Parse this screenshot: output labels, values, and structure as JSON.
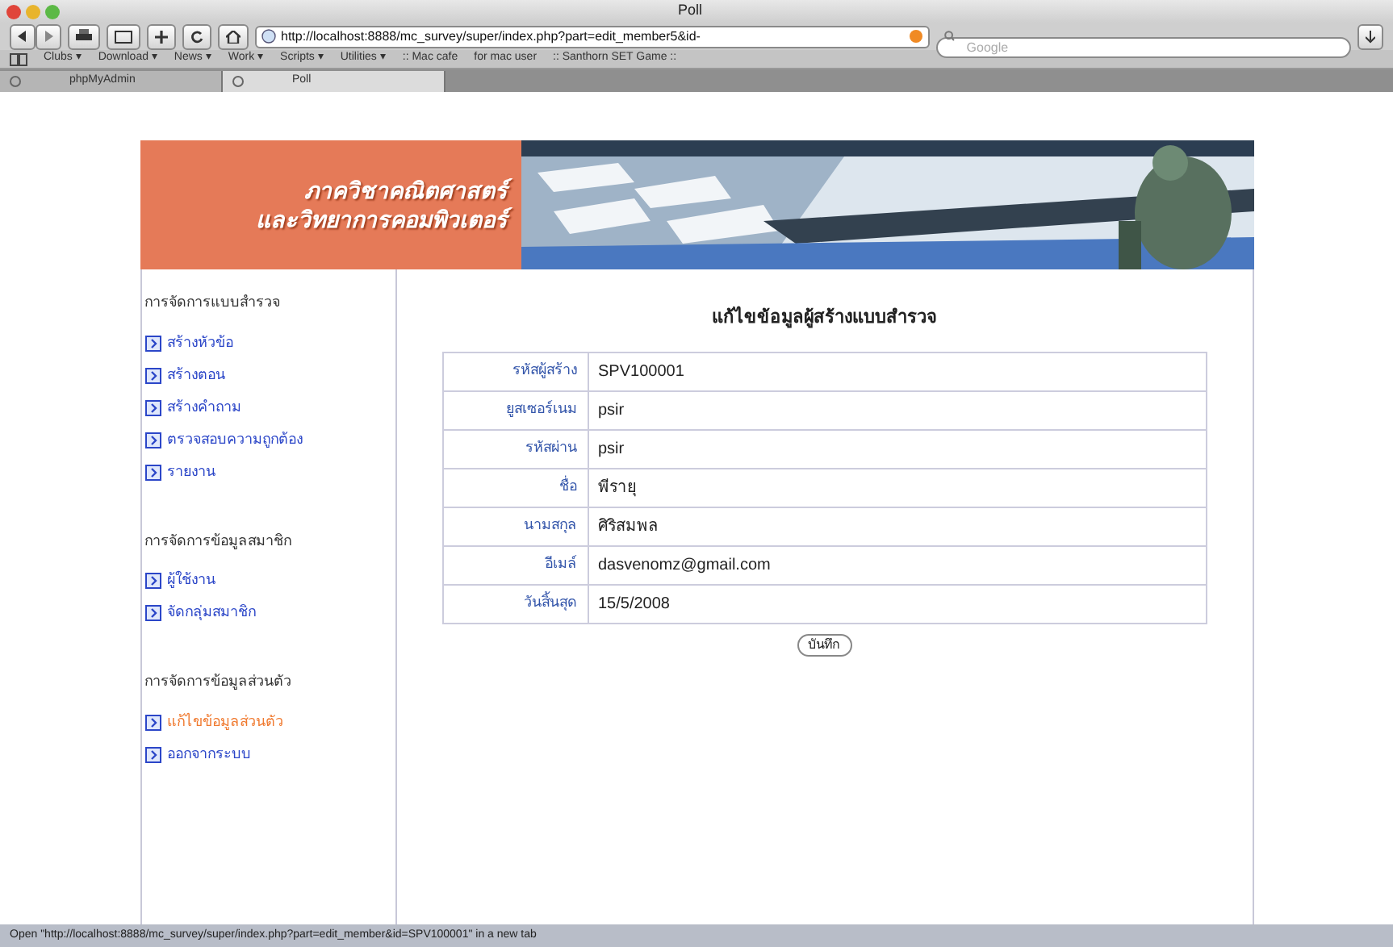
{
  "window": {
    "title": "Poll"
  },
  "toolbar": {
    "url": "http://localhost:8888/mc_survey/super/index.php?part=edit_member5&id-",
    "search_placeholder": "Google"
  },
  "bookmarks": [
    "Clubs ▾",
    "Download ▾",
    "News ▾",
    "Work ▾",
    "Scripts ▾",
    "Utilities ▾",
    ":: Mac cafe",
    "for mac user",
    ":: Santhorn SET Game ::"
  ],
  "tabs": [
    {
      "label": "phpMyAdmin",
      "selected": false
    },
    {
      "label": "Poll",
      "selected": true
    }
  ],
  "banner": {
    "title_lines": [
      "ภาควิชาคณิตศาสตร์",
      "และวิทยาการคอมพิวเตอร์"
    ]
  },
  "sidebar": {
    "sections": [
      {
        "heading": "การจัดการแบบสำรวจ",
        "items": [
          {
            "label": "สร้างหัวข้อ",
            "selected": false
          },
          {
            "label": "สร้างตอน",
            "selected": false
          },
          {
            "label": "สร้างคำถาม",
            "selected": false
          },
          {
            "label": "ตรวจสอบความถูกต้อง",
            "selected": false
          },
          {
            "label": "รายงาน",
            "selected": false
          }
        ]
      },
      {
        "heading": "การจัดการข้อมูลสมาชิก",
        "items": [
          {
            "label": "ผู้ใช้งาน",
            "selected": false
          },
          {
            "label": "จัดกลุ่มสมาชิก",
            "selected": false
          }
        ]
      },
      {
        "heading": "การจัดการข้อมูลส่วนตัว",
        "items": [
          {
            "label": "แก้ไขข้อมูลส่วนตัว",
            "selected": true
          },
          {
            "label": "ออกจากระบบ",
            "selected": false
          }
        ]
      }
    ]
  },
  "form": {
    "title": "แก้ไขข้อมูลผู้สร้างแบบสำรวจ",
    "rows": [
      {
        "label": "รหัสผู้สร้าง",
        "value": "SPV100001"
      },
      {
        "label": "ยูสเซอร์เนม",
        "value": "psir"
      },
      {
        "label": "รหัสผ่าน",
        "value": "psir"
      },
      {
        "label": "ชื่อ",
        "value": "พีรายุ"
      },
      {
        "label": "นามสกุล",
        "value": "ศิริสมพล"
      },
      {
        "label": "อีเมล์",
        "value": "dasvenomz@gmail.com"
      },
      {
        "label": "วันสิ้นสุด",
        "value": "15/5/2008"
      }
    ],
    "submit": "บันทึก"
  },
  "status_bar": "Open \"http://localhost:8888/mc_survey/super/index.php?part=edit_member&id=SPV100001\" in a new tab"
}
